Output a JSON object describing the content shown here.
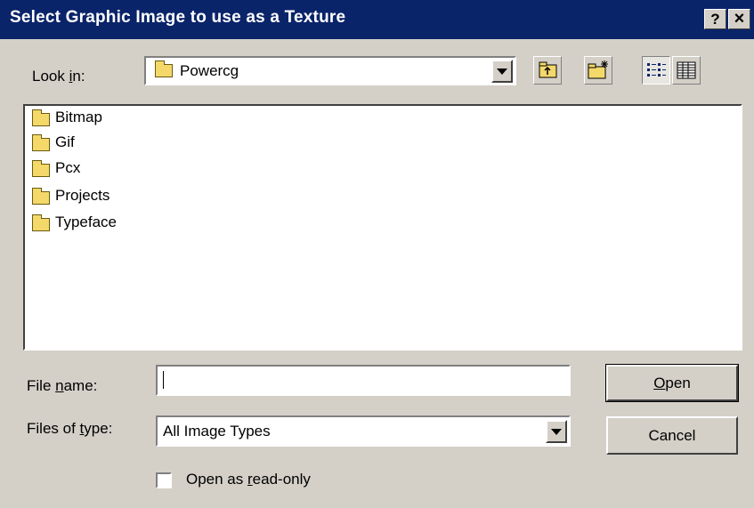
{
  "window": {
    "title": "Select Graphic Image to use as a Texture",
    "help_glyph": "?",
    "close_glyph": "×"
  },
  "look_in": {
    "label_pre": "Look ",
    "label_ul": "i",
    "label_post": "n:",
    "value": "Powercg"
  },
  "toolbar": {
    "icons": [
      "up-one-level-icon",
      "create-new-folder-icon",
      "list-view-icon",
      "details-view-icon"
    ]
  },
  "files": [
    {
      "name": "Bitmap"
    },
    {
      "name": "Gif"
    },
    {
      "name": "Pcx"
    },
    {
      "name": "Projects"
    },
    {
      "name": "Typeface"
    }
  ],
  "file_name": {
    "label_pre": "File ",
    "label_ul": "n",
    "label_post": "ame:",
    "value": ""
  },
  "file_type": {
    "label_pre": "Files of ",
    "label_ul": "t",
    "label_post": "ype:",
    "value": "All Image Types"
  },
  "read_only": {
    "label_pre": "Open as ",
    "label_ul": "r",
    "label_post": "ead-only",
    "checked": false
  },
  "buttons": {
    "open_ul": "O",
    "open_post": "pen",
    "cancel": "Cancel"
  },
  "colors": {
    "titlebar": "#0a246a",
    "face": "#d4d0c8",
    "folder": "#f4d96a"
  }
}
